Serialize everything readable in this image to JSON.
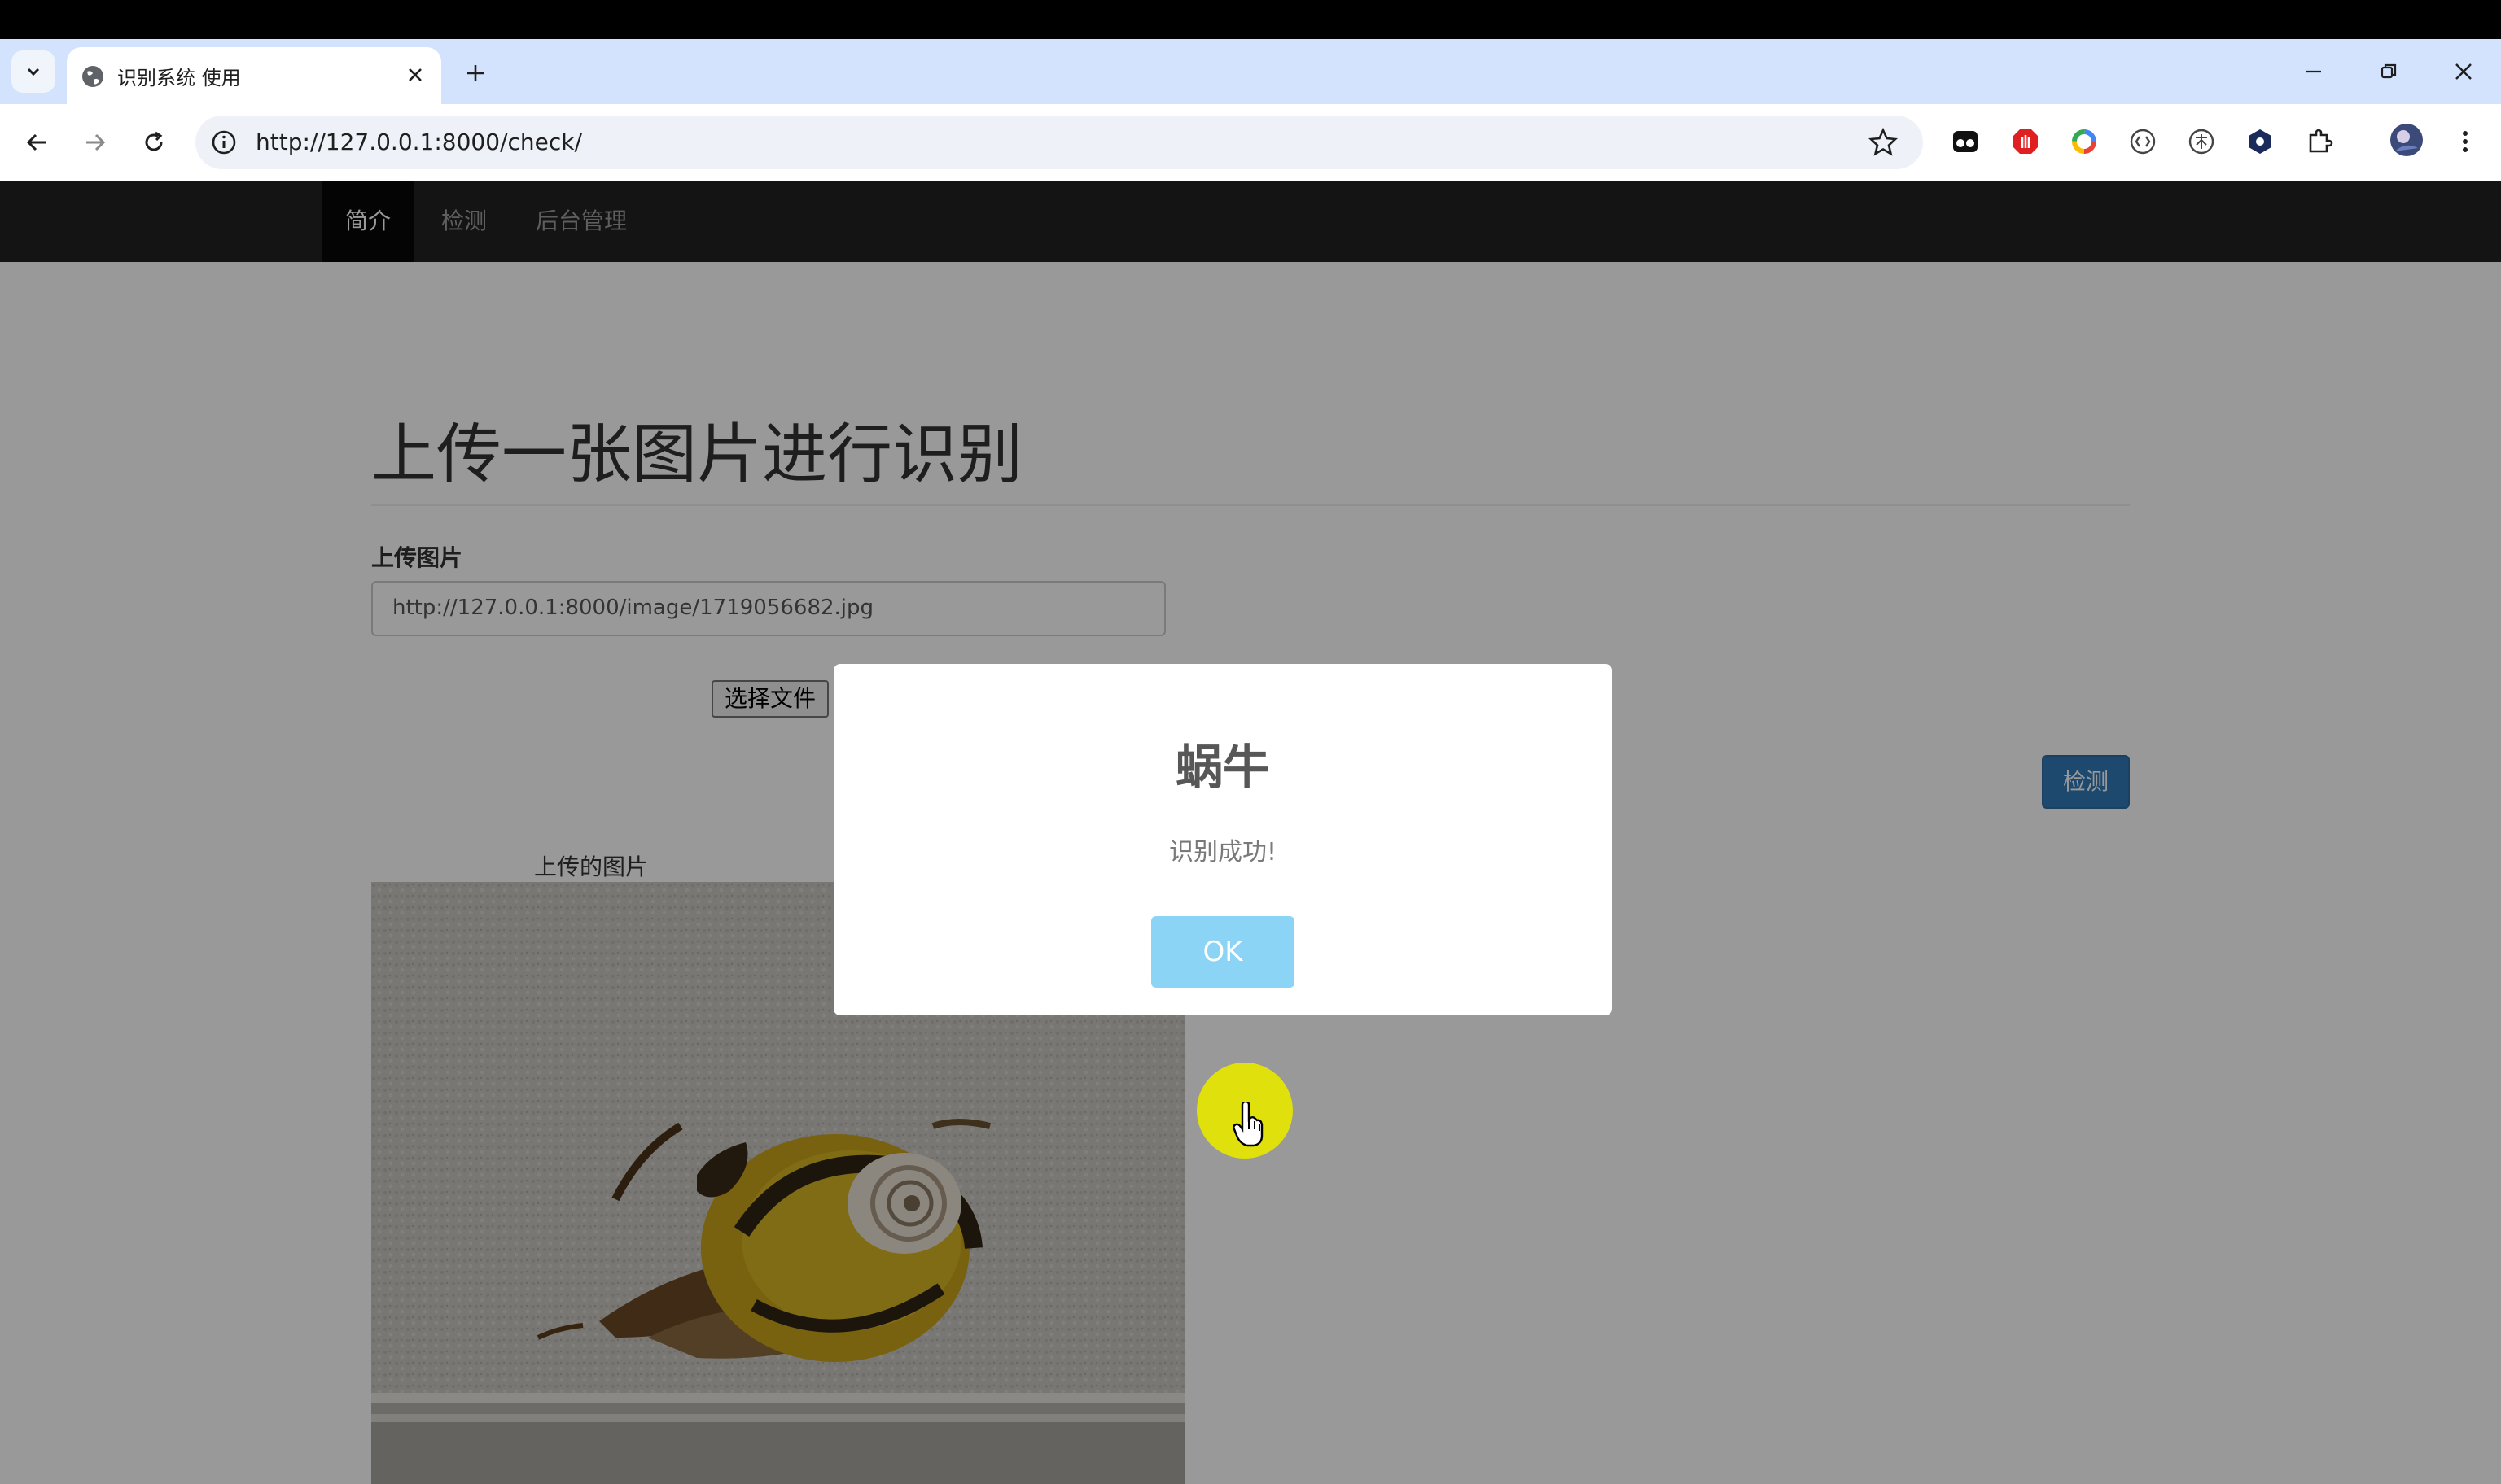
{
  "browser": {
    "tab_title": "识别系统 使用",
    "url": "http://127.0.0.1:8000/check/"
  },
  "nav": {
    "items": [
      "简介",
      "检测",
      "后台管理"
    ],
    "active": "简介"
  },
  "main": {
    "heading": "上传一张图片进行识别",
    "upload_label": "上传图片",
    "upload_value": "http://127.0.0.1:8000/image/1719056682.jpg",
    "file_button": "选择文件",
    "detect_button": "检测",
    "image_caption": "上传的图片"
  },
  "modal": {
    "title": "蜗牛",
    "message": "识别成功!",
    "ok_label": "OK"
  },
  "colors": {
    "navbar": "#222222",
    "primary_button": "#337ab7",
    "ok_button": "#8cd4f5",
    "cursor_highlight": "#e6e600"
  }
}
